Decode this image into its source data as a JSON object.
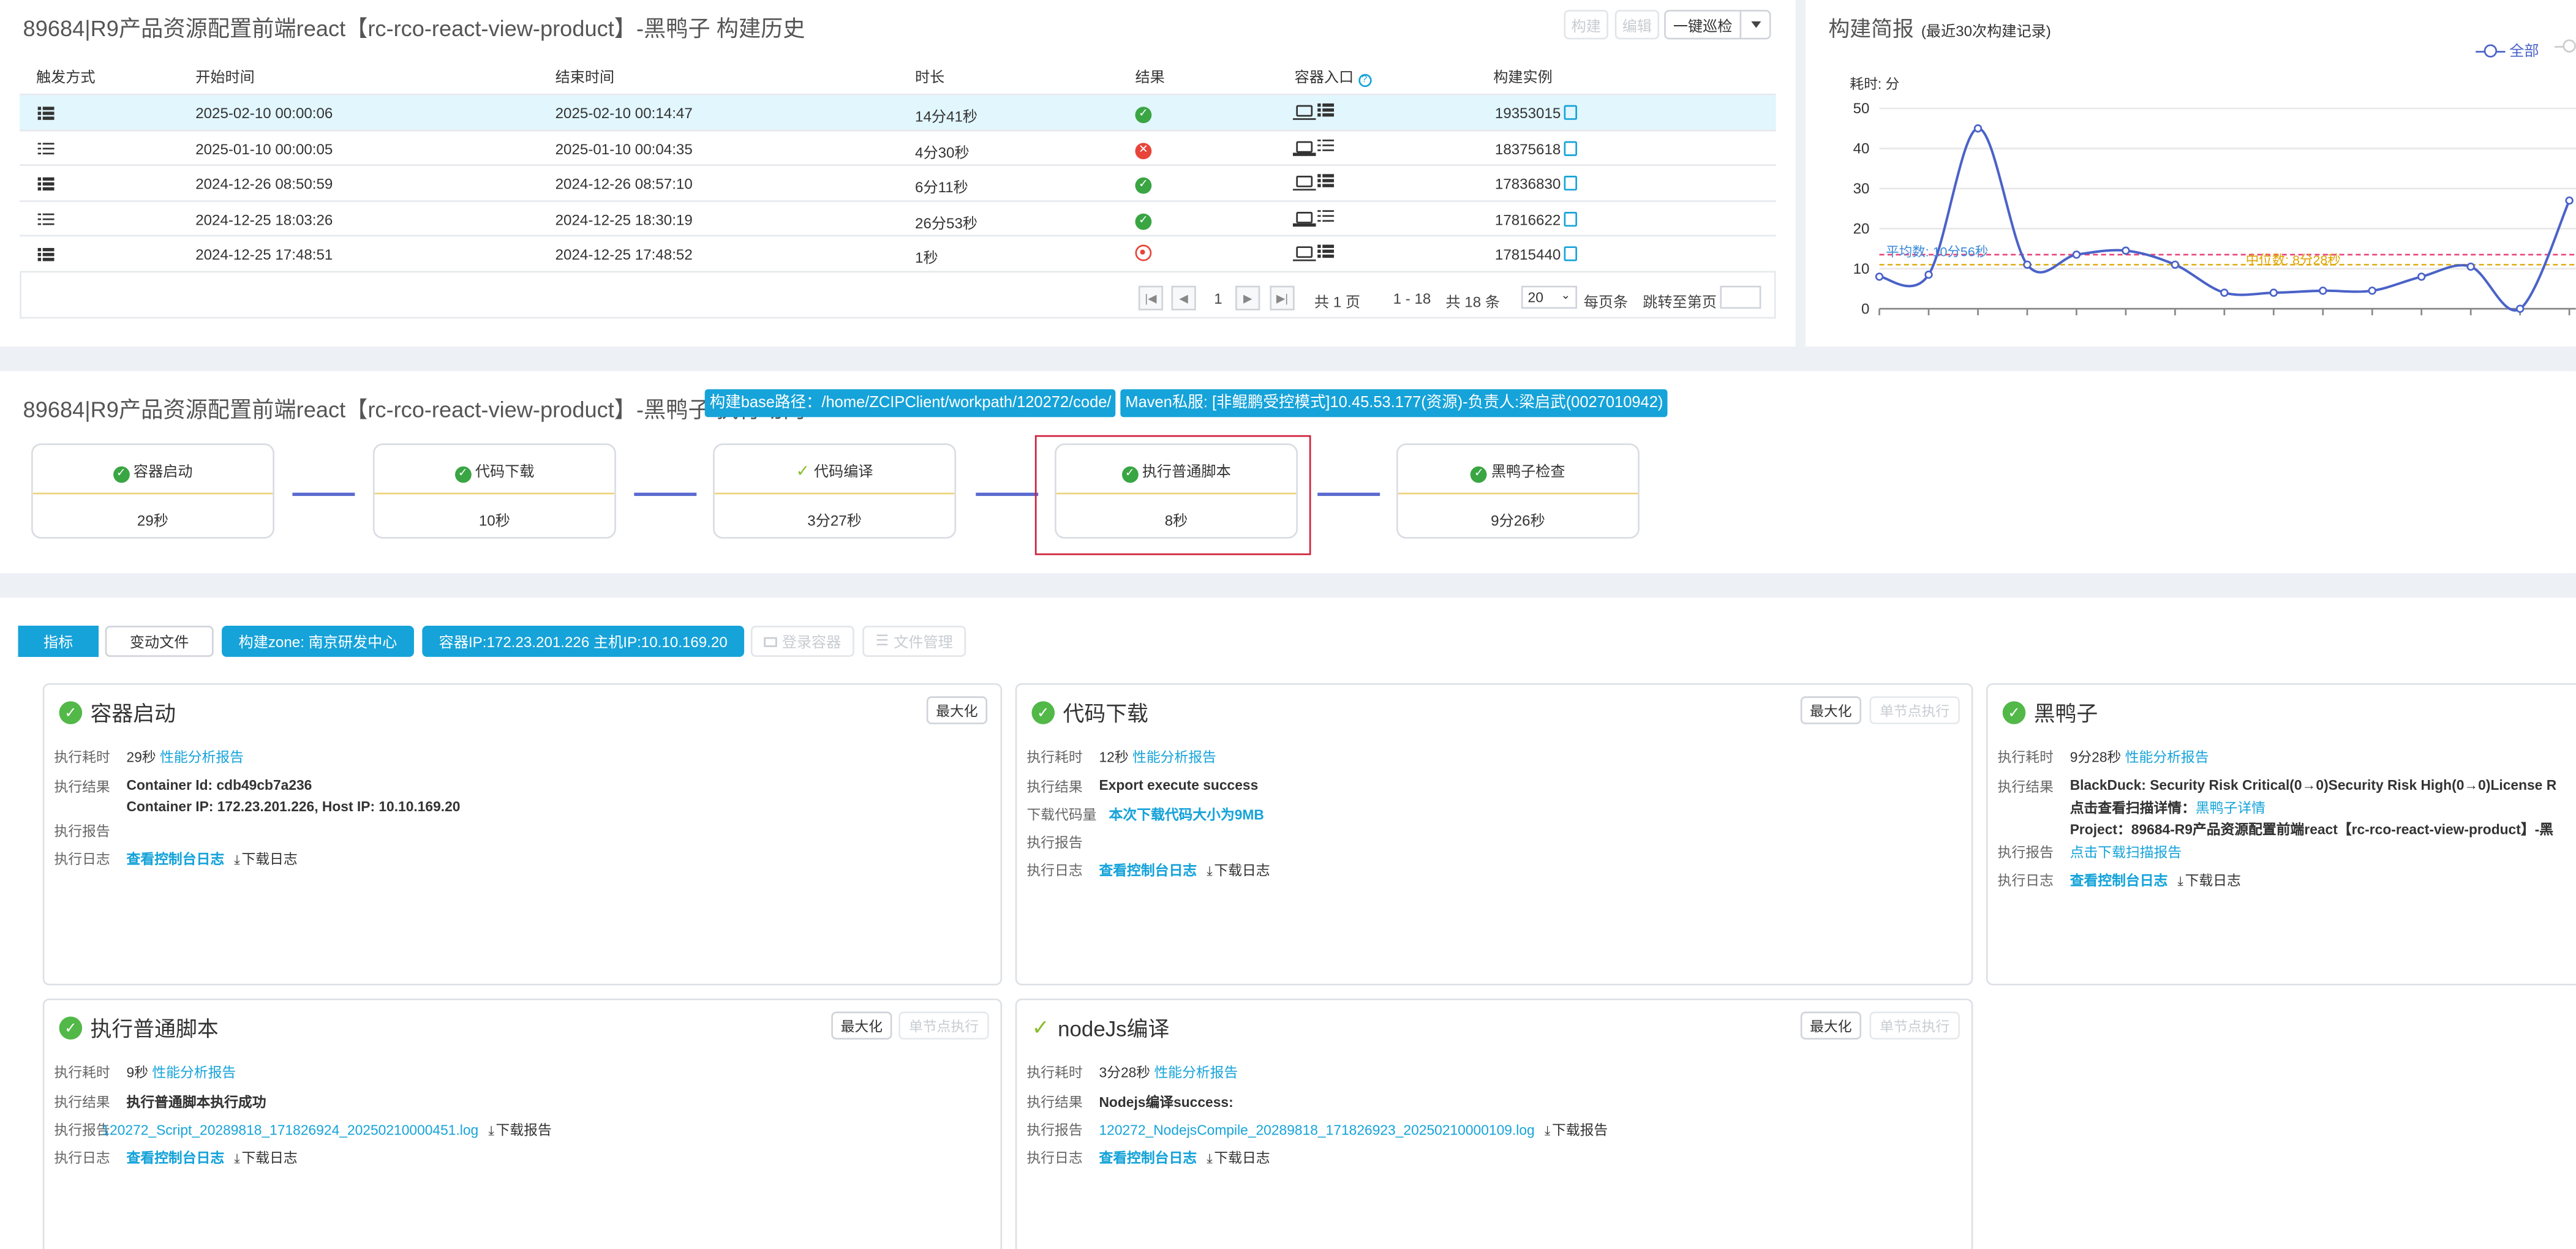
{
  "history": {
    "title": "89684|R9产品资源配置前端react【rc-rco-react-view-product】-黑鸭子 构建历史",
    "buttons": {
      "build": "构建",
      "edit": "编辑",
      "patrol": "一键巡检"
    },
    "columns": [
      "触发方式",
      "开始时间",
      "结束时间",
      "时长",
      "结果",
      "容器入口",
      "构建实例"
    ],
    "rows": [
      {
        "start": "2025-02-10 00:00:06",
        "end": "2025-02-10 00:14:47",
        "duration": "14分41秒",
        "result": "success",
        "instance": "19353015"
      },
      {
        "start": "2025-01-10 00:00:05",
        "end": "2025-01-10 00:04:35",
        "duration": "4分30秒",
        "result": "failed",
        "instance": "18375618"
      },
      {
        "start": "2024-12-26 08:50:59",
        "end": "2024-12-26 08:57:10",
        "duration": "6分11秒",
        "result": "success",
        "instance": "17836830"
      },
      {
        "start": "2024-12-25 18:03:26",
        "end": "2024-12-25 18:30:19",
        "duration": "26分53秒",
        "result": "success",
        "instance": "17816622"
      },
      {
        "start": "2024-12-25 17:48:51",
        "end": "2024-12-25 17:48:52",
        "duration": "1秒",
        "result": "stopped",
        "instance": "17815440"
      }
    ],
    "pager": {
      "page": "1",
      "total_pages": "共 1 页",
      "range": "1 - 18",
      "total": "共 18 条",
      "page_size": "20",
      "per_page": "每页条",
      "jump": "跳转至第页"
    }
  },
  "summary": {
    "title": "构建简报",
    "subtitle": "(最近30次构建记录)",
    "legend_all": "全部",
    "ylabel": "耗时: 分",
    "avg_label": "平均数: 10分56秒",
    "median_label": "中位数: 8分28秒"
  },
  "chart_data": {
    "type": "line",
    "title": "构建简报",
    "ylabel": "耗时: 分",
    "ylim": [
      0,
      50
    ],
    "yticks": [
      0,
      10,
      20,
      30,
      40,
      50
    ],
    "series": [
      {
        "name": "全部",
        "values": [
          8,
          8.5,
          45,
          11,
          13.5,
          14.5,
          11,
          4,
          4,
          4.5,
          4.5,
          8,
          10.5,
          0,
          27
        ]
      }
    ],
    "reference_lines": [
      {
        "name": "平均数",
        "value": 13.5,
        "color": "#e8447a"
      },
      {
        "name": "中位数",
        "value": 11,
        "color": "#e0b020"
      }
    ],
    "colors": {
      "line": "#4a62c8"
    },
    "grid": true
  },
  "flow": {
    "title": "89684|R9产品资源配置前端react【rc-rco-react-view-product】-黑鸭子 执行动向",
    "tag1": "构建base路径：/home/ZCIPClient/workpath/120272/code/",
    "tag2": "Maven私服: [非鲲鹏受控模式]10.45.53.177(资源)-负责人:梁启武(0027010942)",
    "stages": [
      {
        "name": "容器启动",
        "time": "29秒",
        "status": "ok"
      },
      {
        "name": "代码下载",
        "time": "10秒",
        "status": "ok"
      },
      {
        "name": "代码编译",
        "time": "3分27秒",
        "status": "partial"
      },
      {
        "name": "执行普通脚本",
        "time": "8秒",
        "status": "ok"
      },
      {
        "name": "黑鸭子检查",
        "time": "9分26秒",
        "status": "ok"
      }
    ]
  },
  "tabs": {
    "metrics": "指标",
    "changes": "变动文件",
    "zone": "构建zone: 南京研发中心",
    "ip": "容器IP:172.23.201.226 主机IP:10.10.169.20",
    "login": "登录容器",
    "files": "文件管理"
  },
  "labels": {
    "elapsed": "执行耗时",
    "result": "执行结果",
    "report": "执行报告",
    "log": "执行日志",
    "download_size": "下载代码量",
    "perf": "性能分析报告",
    "console": "查看控制台日志",
    "download_log": "下载日志",
    "download_report": "下载报告",
    "maximize": "最大化",
    "single": "单节点执行"
  },
  "cards": {
    "c1": {
      "title": "容器启动",
      "elapsed": "29秒",
      "result1": "Container Id: cdb49cb7a236",
      "result2": "Container IP: 172.23.201.226, Host IP: 10.10.169.20"
    },
    "c2": {
      "title": "代码下载",
      "elapsed": "12秒",
      "result": "Export execute success",
      "size": "本次下载代码大小为9MB"
    },
    "c3": {
      "title": "黑鸭子",
      "elapsed": "9分28秒",
      "result1": "BlackDuck: Security Risk Critical(0→0)Security Risk High(0→0)License R",
      "result2_label": "点击查看扫描详情：",
      "result2_link": "黑鸭子详情",
      "result3": "Project：89684-R9产品资源配置前端react【rc-rco-react-view-product】-黑",
      "report": "点击下载扫描报告"
    },
    "c4": {
      "title": "执行普通脚本",
      "elapsed": "9秒",
      "result": "执行普通脚本执行成功",
      "report": "120272_Script_20289818_171826924_20250210000451.log"
    },
    "c5": {
      "title": "nodeJs编译",
      "elapsed": "3分28秒",
      "result": "Nodejs编译success:",
      "report": "120272_NodejsCompile_20289818_171826923_20250210000109.log"
    }
  }
}
